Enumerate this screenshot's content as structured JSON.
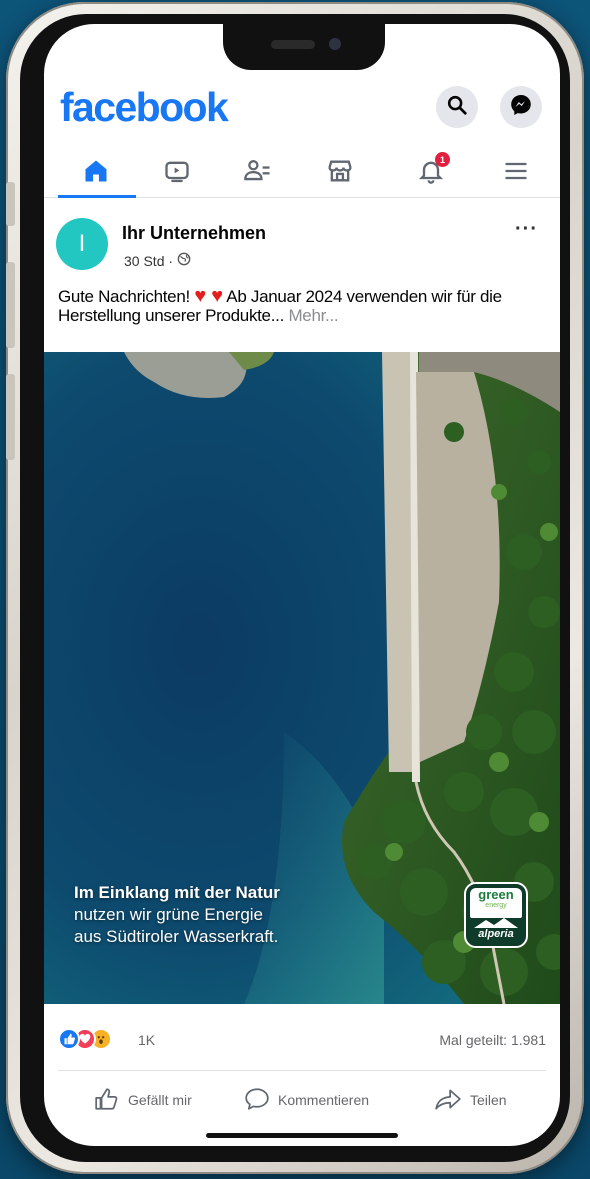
{
  "app": {
    "logo": "facebook"
  },
  "header": {
    "search_icon": "search-icon",
    "messenger_icon": "messenger-icon"
  },
  "nav": {
    "items": [
      {
        "icon": "home-icon",
        "active": true
      },
      {
        "icon": "video-icon"
      },
      {
        "icon": "friends-icon"
      },
      {
        "icon": "marketplace-icon"
      },
      {
        "icon": "bell-icon",
        "badge": "1"
      },
      {
        "icon": "menu-icon"
      }
    ]
  },
  "post": {
    "avatar_letter": "I",
    "page_name": "Ihr Unternehmen",
    "time": "30 Std ·",
    "text_before_hearts": "Gute Nachrichten!",
    "hearts": "♥ ♥",
    "text_after_hearts": " Ab Januar 2024 verwenden wir für die Herstellung unserer Produkte...",
    "more_link": " Mehr...",
    "more_options": "···",
    "image": {
      "caption_line1": "Im Einklang mit der Natur",
      "caption_line2": "nutzen wir grüne Energie",
      "caption_line3": "aus Südtiroler Wasserkraft.",
      "logo_green": "green",
      "logo_energy": "energy",
      "logo_brand": "alperia"
    },
    "reactions_count": "1K",
    "shares": "Mal geteilt: 1.981",
    "actions": {
      "like": "Gefällt mir",
      "comment": "Kommentieren",
      "share": "Teilen"
    }
  },
  "colors": {
    "brand": "#1877f2",
    "badge": "#e41e3f",
    "avatar": "#22c7c2"
  }
}
